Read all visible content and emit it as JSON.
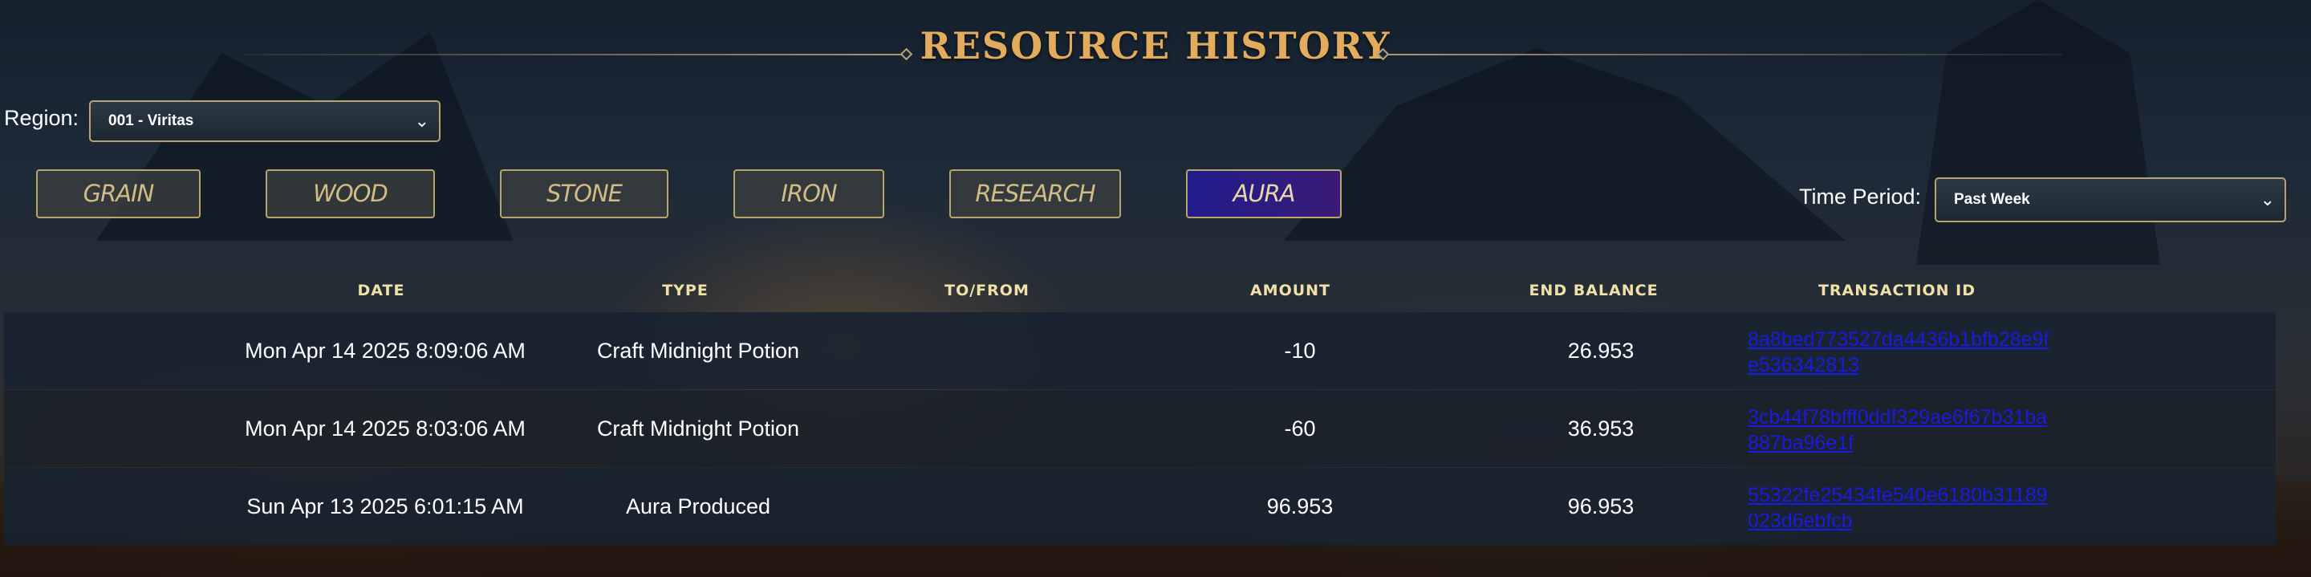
{
  "page": {
    "title": "RESOURCE HISTORY"
  },
  "filters": {
    "region_label": "Region:",
    "region_value": "001 - Viritas",
    "time_label": "Time Period:",
    "time_value": "Past Week"
  },
  "resources": [
    {
      "label": "GRAIN",
      "active": false
    },
    {
      "label": "WOOD",
      "active": false
    },
    {
      "label": "STONE",
      "active": false
    },
    {
      "label": "IRON",
      "active": false
    },
    {
      "label": "RESEARCH",
      "active": false
    },
    {
      "label": "AURA",
      "active": true
    }
  ],
  "table": {
    "columns": [
      "DATE",
      "TYPE",
      "TO/FROM",
      "AMOUNT",
      "END BALANCE",
      "TRANSACTION ID"
    ],
    "rows": [
      {
        "date": "Mon Apr 14 2025 8:09:06 AM",
        "type": "Craft Midnight Potion",
        "to_from": "",
        "amount": "-10",
        "end_balance": "26.953",
        "transaction_id": "8a8bed773527da4436b1bfb28e9fe536342813"
      },
      {
        "date": "Mon Apr 14 2025 8:03:06 AM",
        "type": "Craft Midnight Potion",
        "to_from": "",
        "amount": "-60",
        "end_balance": "36.953",
        "transaction_id": "3cb44f78bfff0ddf329ae6f67b31ba887ba96e1f"
      },
      {
        "date": "Sun Apr 13 2025 6:01:15 AM",
        "type": "Aura Produced",
        "to_from": "",
        "amount": "96.953",
        "end_balance": "96.953",
        "transaction_id": "55322fe25434fe540e6180b31189023d6ebfcb"
      }
    ]
  },
  "colors": {
    "accent_gold": "#e3ac5d",
    "button_border": "#b8a46c",
    "active_button": "#201c8c",
    "link": "#1b1ae0"
  },
  "icons": {
    "dropdown": "chevron-down-icon"
  }
}
